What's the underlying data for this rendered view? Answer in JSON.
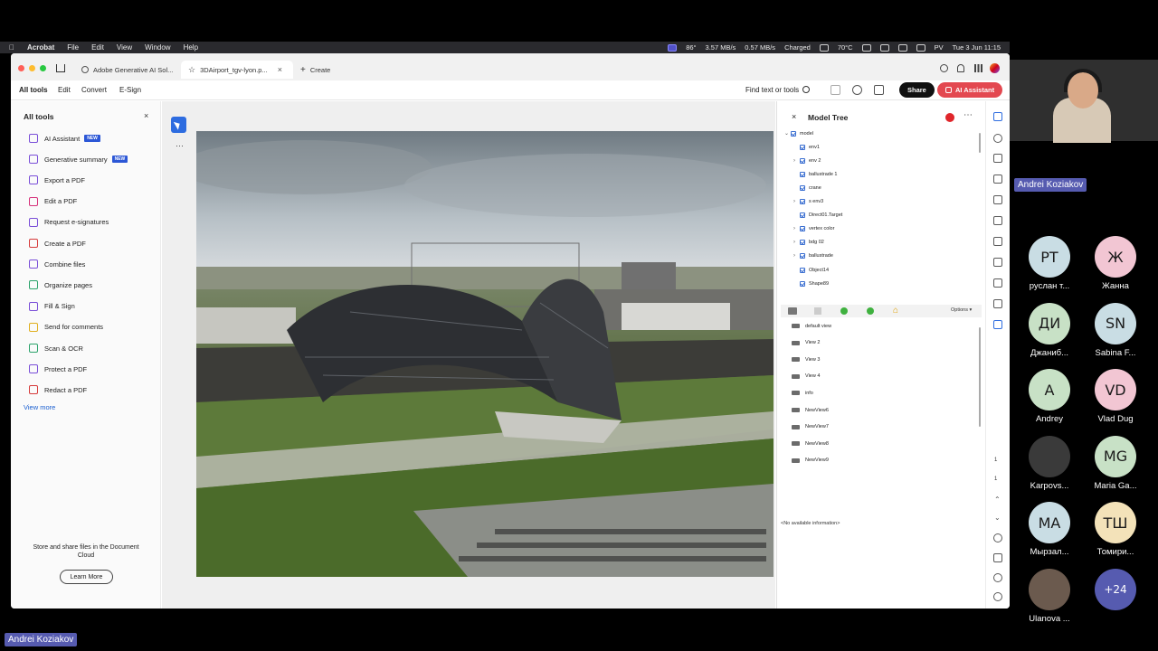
{
  "menubar": {
    "app": "Acrobat",
    "items": [
      "File",
      "Edit",
      "View",
      "Window",
      "Help"
    ],
    "status": [
      "86°",
      "3.57 MB/s",
      "0.57 MB/s",
      "Charged",
      "70°C",
      "PV"
    ],
    "clock": "Tue 3 Jun 11:15"
  },
  "tabs": [
    {
      "label": "Adobe Generative AI Sol..."
    },
    {
      "label": "3DAirport_tgv-lyon.p..."
    },
    {
      "label": "Create"
    }
  ],
  "toolbar": {
    "items": [
      "All tools",
      "Edit",
      "Convert",
      "E-Sign"
    ],
    "find": "Find text or tools",
    "share": "Share",
    "ai": "AI Assistant"
  },
  "left_panel": {
    "title": "All tools",
    "badge": "NEW",
    "items": [
      {
        "label": "AI Assistant",
        "color": "#7a4fd8"
      },
      {
        "label": "Generative summary",
        "color": "#7a4fd8"
      },
      {
        "label": "Export a PDF",
        "color": "#7a4fd8"
      },
      {
        "label": "Edit a PDF",
        "color": "#d6317a"
      },
      {
        "label": "Request e-signatures",
        "color": "#7a4fd8"
      },
      {
        "label": "Create a PDF",
        "color": "#d63b3b"
      },
      {
        "label": "Combine files",
        "color": "#7a4fd8"
      },
      {
        "label": "Organize pages",
        "color": "#2ca36b"
      },
      {
        "label": "Fill & Sign",
        "color": "#7a4fd8"
      },
      {
        "label": "Send for comments",
        "color": "#e0b020"
      },
      {
        "label": "Scan & OCR",
        "color": "#2ca36b"
      },
      {
        "label": "Protect a PDF",
        "color": "#7a4fd8"
      },
      {
        "label": "Redact a PDF",
        "color": "#d63b3b"
      }
    ],
    "view_more": "View more",
    "store_text": "Store and share files in the Document Cloud",
    "learn_more": "Learn More"
  },
  "model_tree": {
    "title": "Model Tree",
    "nodes": [
      {
        "label": "model",
        "expanded": true
      },
      {
        "label": "env1"
      },
      {
        "label": "env 2"
      },
      {
        "label": "ballustrade 1"
      },
      {
        "label": "crane"
      },
      {
        "label": "s env3"
      },
      {
        "label": "Direct01.Target"
      },
      {
        "label": "vertex color"
      },
      {
        "label": "bdg 02"
      },
      {
        "label": "ballustrade"
      },
      {
        "label": "Object14"
      },
      {
        "label": "Shape89"
      }
    ],
    "options": "Options",
    "views": [
      "default view",
      "View 2",
      "View 3",
      "View 4",
      "info",
      "NewView6",
      "NewView7",
      "NewView8",
      "NewView9"
    ],
    "no_info": "<No available information>"
  },
  "page_indicator": {
    "current": "1",
    "total": "1"
  },
  "call": {
    "presenter": "Andrei Koziakov",
    "participants": [
      {
        "initials": "РТ",
        "name": "руслан т...",
        "color": "#c9dde4"
      },
      {
        "initials": "Ж",
        "name": "Жанна",
        "color": "#f2c6d3"
      },
      {
        "initials": "ДИ",
        "name": "Джаниб...",
        "color": "#c8e1c6"
      },
      {
        "initials": "SN",
        "name": "Sabina F...",
        "color": "#c9dde4"
      },
      {
        "initials": "A",
        "name": "Andrey",
        "color": "#c8e1c6"
      },
      {
        "initials": "VD",
        "name": "Vlad Dug",
        "color": "#f2c6d3"
      },
      {
        "initials": "",
        "name": "Karpovs...",
        "color": "#3a3a3a"
      },
      {
        "initials": "MG",
        "name": "Maria Ga...",
        "color": "#c8e1c6"
      },
      {
        "initials": "MA",
        "name": "Мырзал...",
        "color": "#c9dde4"
      },
      {
        "initials": "ТШ",
        "name": "Томири...",
        "color": "#f3e2b9"
      },
      {
        "initials": "",
        "name": "Ulanova ...",
        "color": "#6b5a4e"
      }
    ],
    "more": "+24",
    "more_color": "#565bb0"
  },
  "bottom_name": "Andrei Koziakov"
}
